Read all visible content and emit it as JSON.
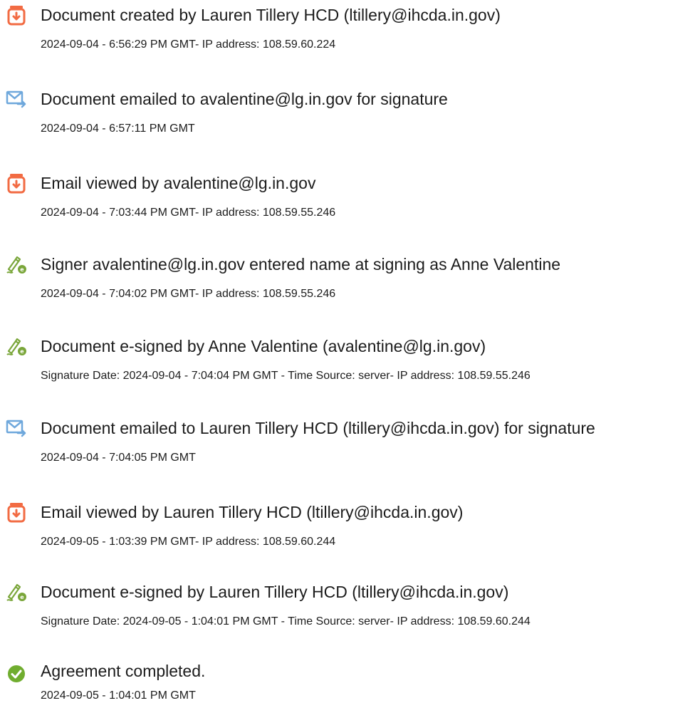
{
  "events": [
    {
      "icon": "document-created-icon",
      "title": "Document created by Lauren Tillery HCD (ltillery@ihcda.in.gov)",
      "detail": "2024-09-04 - 6:56:29 PM GMT- IP address: 108.59.60.224"
    },
    {
      "icon": "email-sent-icon",
      "title": "Document emailed to avalentine@lg.in.gov for signature",
      "detail": "2024-09-04 - 6:57:11 PM GMT"
    },
    {
      "icon": "document-viewed-icon",
      "title": "Email viewed by avalentine@lg.in.gov",
      "detail": "2024-09-04 - 7:03:44 PM GMT- IP address: 108.59.55.246"
    },
    {
      "icon": "signature-pen-icon",
      "title": "Signer avalentine@lg.in.gov entered name at signing as Anne Valentine",
      "detail": "2024-09-04 - 7:04:02 PM GMT- IP address: 108.59.55.246"
    },
    {
      "icon": "signature-pen-icon",
      "title": "Document e-signed by Anne Valentine (avalentine@lg.in.gov)",
      "detail": "Signature Date: 2024-09-04 - 7:04:04 PM GMT - Time Source: server- IP address: 108.59.55.246"
    },
    {
      "icon": "email-sent-icon",
      "title": "Document emailed to Lauren Tillery HCD (ltillery@ihcda.in.gov) for signature",
      "detail": "2024-09-04 - 7:04:05 PM GMT"
    },
    {
      "icon": "document-viewed-icon",
      "title": "Email viewed by Lauren Tillery HCD (ltillery@ihcda.in.gov)",
      "detail": "2024-09-05 - 1:03:39 PM GMT- IP address: 108.59.60.244"
    },
    {
      "icon": "signature-pen-icon",
      "title": "Document e-signed by Lauren Tillery HCD (ltillery@ihcda.in.gov)",
      "detail": "Signature Date: 2024-09-05 - 1:04:01 PM GMT - Time Source: server- IP address: 108.59.60.244"
    },
    {
      "icon": "checkmark-circle-icon",
      "title": "Agreement completed.",
      "detail": "2024-09-05 - 1:04:01 PM GMT"
    }
  ],
  "colors": {
    "document_icon": "#f26b43",
    "email_icon": "#6fa8dc",
    "pen_icon": "#7aa63a",
    "check_icon": "#70ad2f",
    "text": "#1c1c1c"
  }
}
